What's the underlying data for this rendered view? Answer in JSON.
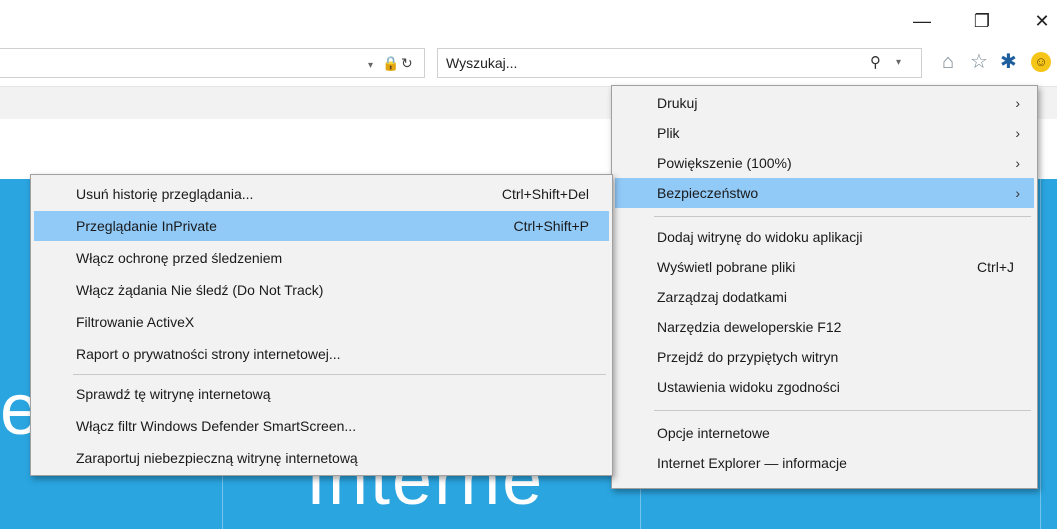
{
  "window": {
    "minimize_glyph": "—",
    "restore_glyph": "❐",
    "close_glyph": "✕"
  },
  "address_bar": {
    "dropdown_glyph": "▾",
    "lock_glyph": "🔒",
    "refresh_glyph": "↻"
  },
  "search": {
    "placeholder": "Wyszukaj...",
    "search_glyph": "⚲",
    "dropdown_glyph": "▾"
  },
  "toolbar": {
    "home_glyph": "⌂",
    "favorites_glyph": "☆",
    "tools_glyph": "✱",
    "feedback_glyph": "☺"
  },
  "hero": {
    "brand_fragment": "Interne",
    "left_fragment": "e"
  },
  "tools_menu": {
    "items": [
      {
        "label": "Drukuj",
        "shortcut": "",
        "arrow": "›"
      },
      {
        "label": "Plik",
        "shortcut": "",
        "arrow": "›"
      },
      {
        "label": "Powiększenie (100%)",
        "shortcut": "",
        "arrow": "›"
      },
      {
        "label": "Bezpieczeństwo",
        "shortcut": "",
        "arrow": "›"
      },
      {
        "label": "Dodaj witrynę do widoku aplikacji",
        "shortcut": ""
      },
      {
        "label": "Wyświetl pobrane pliki",
        "shortcut": "Ctrl+J"
      },
      {
        "label": "Zarządzaj dodatkami",
        "shortcut": ""
      },
      {
        "label": "Narzędzia deweloperskie F12",
        "shortcut": ""
      },
      {
        "label": "Przejdź do przypiętych witryn",
        "shortcut": ""
      },
      {
        "label": "Ustawienia widoku zgodności",
        "shortcut": ""
      },
      {
        "label": "Opcje internetowe",
        "shortcut": ""
      },
      {
        "label": "Internet Explorer — informacje",
        "shortcut": ""
      }
    ]
  },
  "security_menu": {
    "items": [
      {
        "label": "Usuń historię przeglądania...",
        "shortcut": "Ctrl+Shift+Del"
      },
      {
        "label": "Przeglądanie InPrivate",
        "shortcut": "Ctrl+Shift+P"
      },
      {
        "label": "Włącz ochronę przed śledzeniem",
        "shortcut": ""
      },
      {
        "label": "Włącz żądania Nie śledź (Do Not Track)",
        "shortcut": ""
      },
      {
        "label": "Filtrowanie ActiveX",
        "shortcut": ""
      },
      {
        "label": "Raport o prywatności strony internetowej...",
        "shortcut": ""
      },
      {
        "label": "Sprawdź tę witrynę internetową",
        "shortcut": ""
      },
      {
        "label": "Włącz filtr Windows Defender SmartScreen...",
        "shortcut": ""
      },
      {
        "label": "Zaraportuj niebezpieczną witrynę internetową",
        "shortcut": ""
      }
    ]
  },
  "colors": {
    "highlight": "#91c9f7",
    "menu_bg": "#f2f2f2",
    "hero_bg": "#2aa5e0"
  }
}
